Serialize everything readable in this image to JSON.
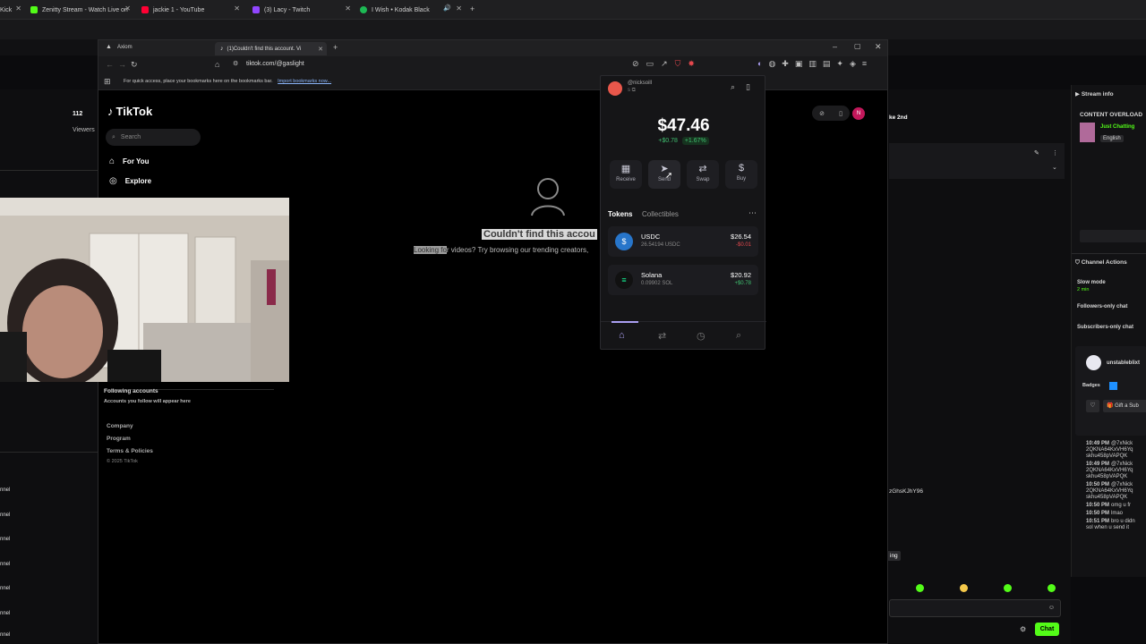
{
  "outer_tabs": [
    {
      "title": "Kick",
      "color": "#53fc18"
    },
    {
      "title": "Zenitty Stream - Watch Live on",
      "color": "#53fc18"
    },
    {
      "title": "jackie 1 - YouTube",
      "color": "#ff0033"
    },
    {
      "title": "(3) Lacy - Twitch",
      "color": "#9146ff"
    },
    {
      "title": "I Wish • Kodak Black",
      "color": "#1db954"
    }
  ],
  "inner_tabs": [
    {
      "title": "Axiom"
    },
    {
      "title": "(1)Couldn't find this account. Vi"
    }
  ],
  "address": "tiktok.com/@gaslight",
  "bookmarks": {
    "text": "For quick access, place your bookmarks here on the bookmarks bar.",
    "link": "Import bookmarks now..."
  },
  "left_stats": {
    "count": "112",
    "label": "Viewers"
  },
  "tiktok": {
    "logo": "TikTok",
    "search_placeholder": "Search",
    "nav": [
      {
        "label": "For You",
        "icon": "home-icon"
      },
      {
        "label": "Explore",
        "icon": "compass-icon"
      }
    ],
    "following_title": "Following accounts",
    "following_sub": "Accounts you follow will appear here",
    "footer": [
      "Company",
      "Program",
      "Terms & Policies"
    ],
    "copyright": "© 2025 TikTok",
    "error_title": "Couldn't find this accou",
    "error_sub_hl": "Looking fo",
    "error_sub": "r videos? Try browsing our trending creators,"
  },
  "wallet": {
    "username": "@nicksoill",
    "balance": "$47.46",
    "change_abs": "+$0.78",
    "change_pct": "+1.67%",
    "actions": [
      "Receive",
      "Send",
      "Swap",
      "Buy"
    ],
    "tabs": [
      "Tokens",
      "Collectibles"
    ],
    "tokens": [
      {
        "name": "USDC",
        "amount": "26.54194 USDC",
        "value": "$26.54",
        "change": "-$0.01",
        "change_color": "#e5484d"
      },
      {
        "name": "Solana",
        "amount": "0.09902 SOL",
        "value": "$20.92",
        "change": "+$0.78",
        "change_color": "#3fbf6f"
      }
    ],
    "accent": "#ab9ff2"
  },
  "stream_info": {
    "title": "Stream info",
    "content": "CONTENT OVERLOAD",
    "category": "Just Chatting",
    "language": "English"
  },
  "channel_actions": {
    "title": "Channel Actions",
    "slow_mode": "Slow mode",
    "slow_time": "2 min",
    "followers_only": "Followers-only chat",
    "subs_only": "Subscribers-only chat"
  },
  "user_card": {
    "name": "unstableblixt",
    "badges": "Badges",
    "gift": "Gift a Sub"
  },
  "chat": [
    {
      "time": "10:49 PM",
      "text": "@7xNick"
    },
    {
      "time": "",
      "text": "2QKNA64KxVH6Yq"
    },
    {
      "time": "",
      "text": "skhu458pVAPQK"
    },
    {
      "time": "10:49 PM",
      "text": "@7xNick"
    },
    {
      "time": "",
      "text": "2QKNA64KxVH6Yq"
    },
    {
      "time": "",
      "text": "skhu458pVAPQK"
    },
    {
      "time": "10:50 PM",
      "text": "@7xNick"
    },
    {
      "time": "",
      "text": "2QKNA64KxVH6Yq"
    },
    {
      "time": "",
      "text": "skhu458pVAPQK"
    },
    {
      "time": "10:50 PM",
      "text": "omg u fr"
    },
    {
      "time": "10:50 PM",
      "text": "lmao"
    },
    {
      "time": "10:51 PM",
      "text": "bro u didn"
    },
    {
      "time": "",
      "text": "sol when u send it"
    }
  ],
  "misc": {
    "chip": "ke 2nd",
    "hash": "zGhsKJhY96",
    "ing": "ing",
    "chat_button": "Chat"
  },
  "left_labels": [
    "nnel",
    "nnel",
    "nnel",
    "nnel",
    "nnel",
    "nnel",
    "nnel"
  ]
}
